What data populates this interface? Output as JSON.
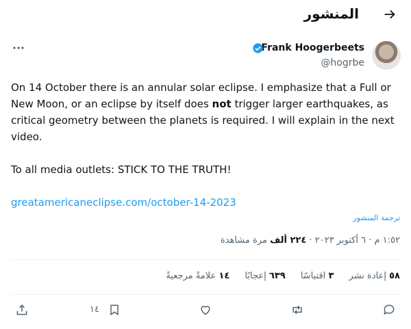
{
  "header": {
    "title": "المنشور"
  },
  "author": {
    "name": "Frank Hoogerbeets",
    "handle": "@hogrbe"
  },
  "post": {
    "line1_a": "On 14 October there is an annular solar eclipse. I emphasize that a Full or New Moon, or an eclipse by itself does ",
    "line1_bold": "not",
    "line1_b": " trigger larger earthquakes, as critical geometry between the planets is required. I will explain in the next video.",
    "line2": "To all media outlets: STICK TO THE TRUTH!",
    "link": "greatamericaneclipse.com/october-14-2023"
  },
  "translate_label": "ترجمة المنشور",
  "meta": {
    "time_date": "١:٥٢ م · ٦ أكتوبر ٢٠٢٣ · ",
    "views_count": "٢٢٤ ألف",
    "views_label": " مرة مشاهدة"
  },
  "stats": {
    "reposts_count": "٥٨",
    "reposts_label": "إعادة نشر",
    "quotes_count": "٣",
    "quotes_label": "اقتباسًا",
    "likes_count": "٦٣٩",
    "likes_label": "إعجابًا",
    "bookmarks_count": "١٤",
    "bookmarks_label": "علامةً مرجعيةً"
  },
  "actions": {
    "bookmark_count": "١٤"
  },
  "colors": {
    "accent": "#1d9bf0",
    "muted": "#536471",
    "text": "#0f1419"
  },
  "icons": [
    "back-arrow-icon",
    "verified-badge-icon",
    "more-icon",
    "reply-icon",
    "repost-icon",
    "like-icon",
    "bookmark-icon",
    "share-icon"
  ]
}
